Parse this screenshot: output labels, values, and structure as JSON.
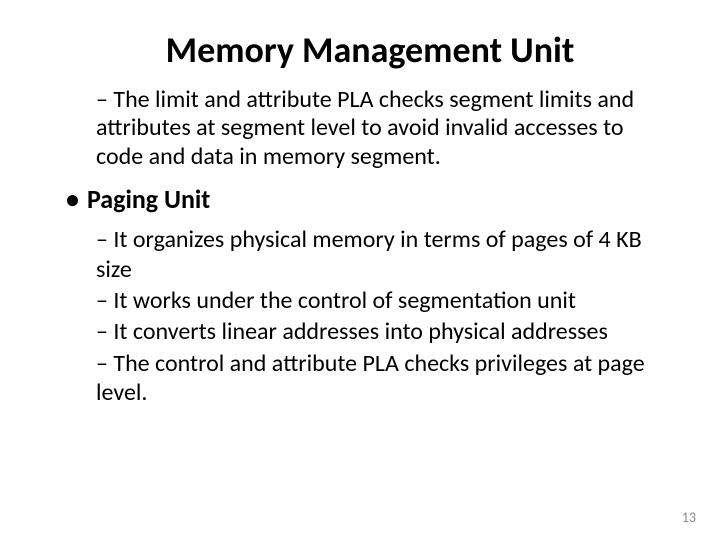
{
  "title": "Memory Management Unit",
  "intro": {
    "dash": "–",
    "text": " The limit and attribute PLA checks segment limits and attributes at segment level to avoid invalid accesses to code and data in memory segment."
  },
  "section": {
    "bullet": "•",
    "heading": "Paging Unit"
  },
  "points": [
    {
      "dash": "–",
      "text": " It organizes physical memory in terms of pages of 4 KB size"
    },
    {
      "dash": "–",
      "text": " It works under the control of segmentation unit"
    },
    {
      "dash": "–",
      "text": " It converts linear addresses into physical addresses"
    },
    {
      "dash": "–",
      "text": " The control and attribute PLA checks privileges at page level."
    }
  ],
  "page_number": "13"
}
